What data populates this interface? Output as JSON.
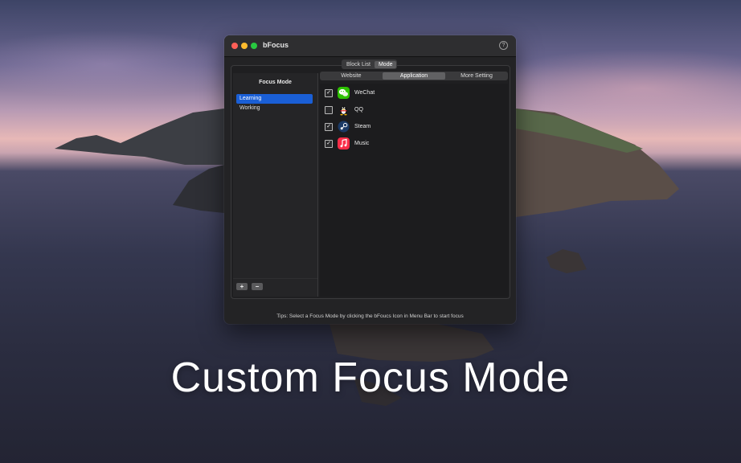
{
  "window": {
    "title": "bFocus",
    "help_glyph": "?"
  },
  "top_segment": {
    "items": [
      {
        "label": "Block List",
        "active": false
      },
      {
        "label": "Mode",
        "active": true
      }
    ]
  },
  "sidebar": {
    "title": "Focus Mode",
    "items": [
      {
        "label": "Learning",
        "selected": true
      },
      {
        "label": "Working",
        "selected": false
      }
    ],
    "add_label": "+",
    "remove_label": "−"
  },
  "tabs": [
    {
      "label": "Website",
      "active": false
    },
    {
      "label": "Application",
      "active": true
    },
    {
      "label": "More Setting",
      "active": false
    }
  ],
  "apps": [
    {
      "name": "WeChat",
      "checked": true,
      "icon": "wechat-icon",
      "color": "#2dc100"
    },
    {
      "name": "QQ",
      "checked": false,
      "icon": "qq-penguin-icon",
      "color": "#111111"
    },
    {
      "name": "Steam",
      "checked": true,
      "icon": "steam-icon",
      "color": "#1b3a66"
    },
    {
      "name": "Music",
      "checked": true,
      "icon": "music-note-icon",
      "color": "#fa2d48"
    }
  ],
  "check_glyph": "✓",
  "tips": "Tips: Select a Focus Mode by clicking the bFoucs Icon in Menu Bar to start focus",
  "headline": "Custom Focus Mode",
  "colors": {
    "accent": "#1a5fd6",
    "close": "#ff5f57",
    "minimize": "#febc2e",
    "zoom": "#28c840"
  }
}
